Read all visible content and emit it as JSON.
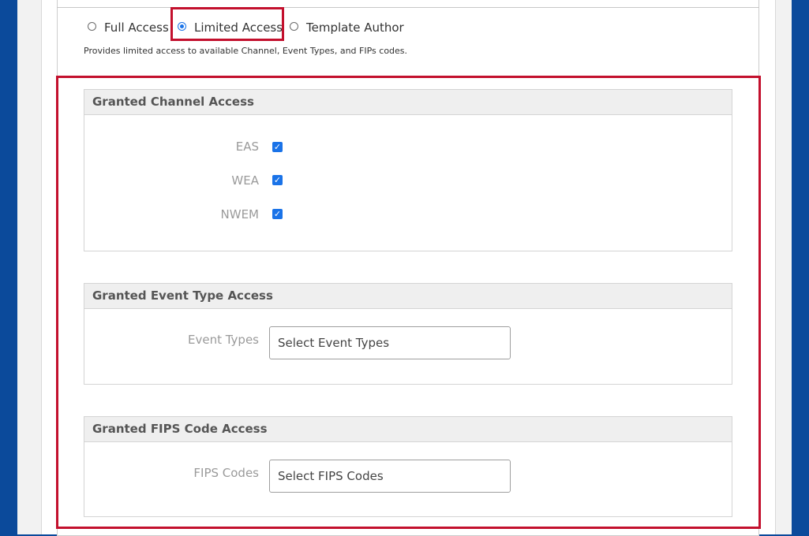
{
  "access_options": {
    "full": "Full Access",
    "limited": "Limited Access",
    "template": "Template Author",
    "selected": "Limited Access",
    "description": "Provides limited access to available Channel, Event Types, and FIPs codes."
  },
  "channel_section": {
    "title": "Granted Channel Access",
    "channels": [
      {
        "label": "EAS",
        "checked": true
      },
      {
        "label": "WEA",
        "checked": true
      },
      {
        "label": "NWEM",
        "checked": true
      }
    ]
  },
  "event_section": {
    "title": "Granted Event Type Access",
    "label": "Event Types",
    "placeholder": "Select Event Types"
  },
  "fips_section": {
    "title": "Granted FIPS Code Access",
    "label": "FIPS Codes",
    "placeholder": "Select FIPS Codes"
  },
  "colors": {
    "page_background": "#0b4a9b",
    "highlight": "#c3102d",
    "accent": "#1a73e8"
  },
  "icons": {
    "checkbox_checked": "checkmark-icon"
  }
}
